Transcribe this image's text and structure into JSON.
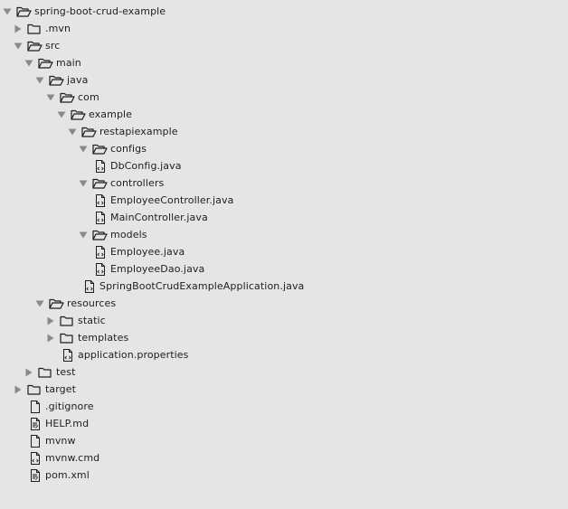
{
  "panel": "project-explorer",
  "tree": [
    {
      "label": "spring-boot-crud-example",
      "type": "folder",
      "depth": 0,
      "expanded": true
    },
    {
      "label": ".mvn",
      "type": "folder",
      "depth": 1,
      "expanded": false
    },
    {
      "label": "src",
      "type": "folder",
      "depth": 1,
      "expanded": true
    },
    {
      "label": "main",
      "type": "folder",
      "depth": 2,
      "expanded": true
    },
    {
      "label": "java",
      "type": "folder",
      "depth": 3,
      "expanded": true
    },
    {
      "label": "com",
      "type": "folder",
      "depth": 4,
      "expanded": true
    },
    {
      "label": "example",
      "type": "folder",
      "depth": 5,
      "expanded": true
    },
    {
      "label": "restapiexample",
      "type": "folder",
      "depth": 6,
      "expanded": true
    },
    {
      "label": "configs",
      "type": "folder",
      "depth": 7,
      "expanded": true
    },
    {
      "label": "DbConfig.java",
      "type": "file",
      "icon": "code-file-icon",
      "depth": 8
    },
    {
      "label": "controllers",
      "type": "folder",
      "depth": 7,
      "expanded": true
    },
    {
      "label": "EmployeeController.java",
      "type": "file",
      "icon": "code-file-icon",
      "depth": 8
    },
    {
      "label": "MainController.java",
      "type": "file",
      "icon": "code-file-icon",
      "depth": 8
    },
    {
      "label": "models",
      "type": "folder",
      "depth": 7,
      "expanded": true
    },
    {
      "label": "Employee.java",
      "type": "file",
      "icon": "code-file-icon",
      "depth": 8
    },
    {
      "label": "EmployeeDao.java",
      "type": "file",
      "icon": "code-file-icon",
      "depth": 8
    },
    {
      "label": "SpringBootCrudExampleApplication.java",
      "type": "file",
      "icon": "code-file-icon",
      "depth": 7
    },
    {
      "label": "resources",
      "type": "folder",
      "depth": 3,
      "expanded": true
    },
    {
      "label": "static",
      "type": "folder",
      "depth": 4,
      "expanded": false
    },
    {
      "label": "templates",
      "type": "folder",
      "depth": 4,
      "expanded": false
    },
    {
      "label": "application.properties",
      "type": "file",
      "icon": "code-file-icon",
      "depth": 5
    },
    {
      "label": "test",
      "type": "folder",
      "depth": 2,
      "expanded": false
    },
    {
      "label": "target",
      "type": "folder",
      "depth": 1,
      "expanded": false
    },
    {
      "label": ".gitignore",
      "type": "file",
      "icon": "plain-file-icon",
      "depth": 2
    },
    {
      "label": "HELP.md",
      "type": "file",
      "icon": "text-file-icon",
      "depth": 2
    },
    {
      "label": "mvnw",
      "type": "file",
      "icon": "plain-file-icon",
      "depth": 2
    },
    {
      "label": "mvnw.cmd",
      "type": "file",
      "icon": "code-file-icon",
      "depth": 2
    },
    {
      "label": "pom.xml",
      "type": "file",
      "icon": "text-file-icon",
      "depth": 2
    }
  ],
  "colors": {
    "background": "#e5e5e5",
    "text": "#1e1e1e",
    "arrow": "#8a8a8a",
    "icon_stroke": "#1e1e1e"
  }
}
